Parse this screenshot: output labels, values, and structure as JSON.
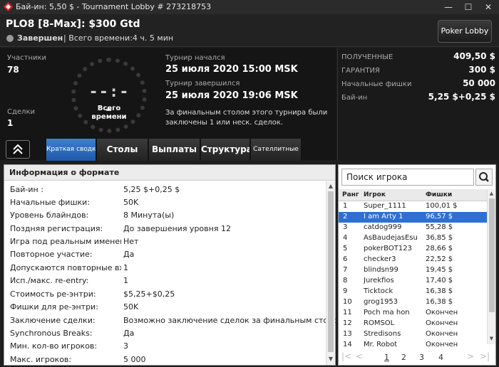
{
  "window": {
    "title": "Бай-ин: 5,50 $ - Tournament Lobby # 273218753",
    "controls": {
      "minimize": "—",
      "maximize": "☐",
      "close": "✕"
    }
  },
  "header": {
    "tournament_name": "PLO8 [8-Max]: $300 Gtd",
    "status": "Завершен",
    "total_time": "| Всего времени:4 ч. 5 мин",
    "lobby_button": "Poker Lobby"
  },
  "info": {
    "participants_label": "Участники",
    "participants_value": "78",
    "deals_label": "Сделки",
    "deals_value": "1",
    "clock_digits": "--:--",
    "clock_label_1": "Всего",
    "clock_label_2": "времени",
    "started_label": "Турнир начался",
    "started_value": "25 июля 2020  15:00 MSK",
    "finished_label": "Турнир завершился",
    "finished_value": "25 июля 2020  19:06 MSK",
    "deals_note": "За финальным столом этого турнира были заключены 1 или неск. сделок."
  },
  "summary": [
    {
      "label": "ПОЛУЧЕННЫЕ",
      "value": "409,50 $"
    },
    {
      "label": "ГАРАНТИЯ",
      "value": "300 $"
    },
    {
      "label": "Начальные фишки",
      "value": "50 000"
    },
    {
      "label": "Бай-ин",
      "value": "5,25 $+0,25 $"
    }
  ],
  "tabs": [
    {
      "label": "Краткая сводка",
      "active": true
    },
    {
      "label": "Столы"
    },
    {
      "label": "Выплаты"
    },
    {
      "label": "Структура"
    },
    {
      "label": "Сателлитные"
    }
  ],
  "format": {
    "title": "Информация о формате",
    "rows": [
      {
        "k": "Бай-ин :",
        "v": "5,25 $+0,25 $"
      },
      {
        "k": "Начальные фишки:",
        "v": "50K"
      },
      {
        "k": "Уровень блайндов:",
        "v": "8 Минута(ы)"
      },
      {
        "k": "Поздняя регистрация:",
        "v": "До завершения уровня 12"
      },
      {
        "k": "Игра под реальным именем",
        "v": "Нет"
      },
      {
        "k": "Повторное участие:",
        "v": "Да"
      },
      {
        "k": "Допускаются повторные вхо...",
        "v": "1"
      },
      {
        "k": "Исп./макс. re-entry:",
        "v": "1"
      },
      {
        "k": "Стоимость ре-энтри:",
        "v": "$5,25+$0,25"
      },
      {
        "k": "Фишки для ре-энтри:",
        "v": "50K"
      },
      {
        "k": "Заключение сделки:",
        "v": "Возможно заключение сделок за финальным столом."
      },
      {
        "k": "Synchronous Breaks:",
        "v": "Да"
      },
      {
        "k": "Мин. кол-во игроков:",
        "v": "3"
      },
      {
        "k": "Макс. игроков:",
        "v": "5 000"
      }
    ]
  },
  "players": {
    "search_placeholder": "Поиск игрока",
    "columns": [
      "Ранг",
      "Игрок",
      "Фишки"
    ],
    "rows": [
      {
        "rank": "1",
        "name": "Super_1111",
        "chips": "100,01 $"
      },
      {
        "rank": "2",
        "name": "I am Arty 1",
        "chips": "96,57 $",
        "selected": true
      },
      {
        "rank": "3",
        "name": "catdog999",
        "chips": "55,28 $"
      },
      {
        "rank": "4",
        "name": "AsBaudejasEsu",
        "chips": "36,85 $"
      },
      {
        "rank": "5",
        "name": "pokerBOT123",
        "chips": "28,66 $"
      },
      {
        "rank": "6",
        "name": "checker3",
        "chips": "22,52 $"
      },
      {
        "rank": "7",
        "name": "blindsn99",
        "chips": "19,45 $"
      },
      {
        "rank": "8",
        "name": "Jurekfios",
        "chips": "17,40 $"
      },
      {
        "rank": "9",
        "name": "Ticktock",
        "chips": "16,38 $"
      },
      {
        "rank": "10",
        "name": "grog1953",
        "chips": "16,38 $"
      },
      {
        "rank": "11",
        "name": "Poch ma hon",
        "chips": "Окончен"
      },
      {
        "rank": "12",
        "name": "ROMSOL",
        "chips": "Окончен"
      },
      {
        "rank": "13",
        "name": "Stredisons",
        "chips": "Окончен"
      },
      {
        "rank": "14",
        "name": "Mr. Robot",
        "chips": "Окончен"
      }
    ],
    "pages": [
      "1",
      "2",
      "3",
      "4"
    ],
    "nav": {
      "first": "|<",
      "prev": "<",
      "next": ">",
      "last": ">|"
    }
  },
  "colors": {
    "accent": "#2f6fd1",
    "background": "#1e1e1e",
    "logo": "#e0242a"
  }
}
